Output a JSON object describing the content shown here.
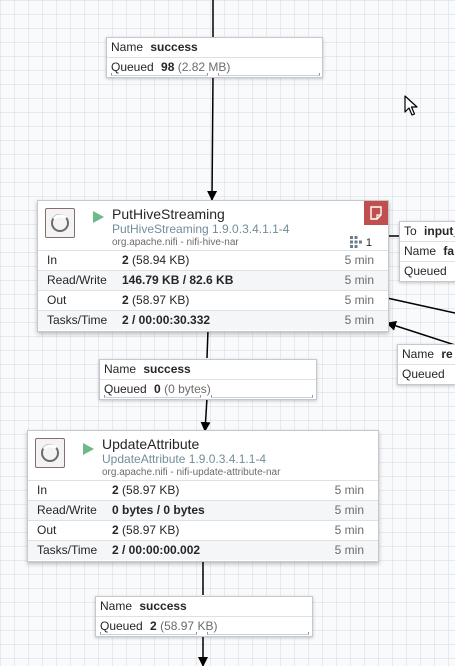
{
  "conn_top": {
    "name_label": "Name",
    "name_value": "success",
    "queued_label": "Queued",
    "queued_count": "98",
    "queued_size": "(2.82 MB)"
  },
  "conn_mid": {
    "name_label": "Name",
    "name_value": "success",
    "queued_label": "Queued",
    "queued_count": "0",
    "queued_size": "(0 bytes)"
  },
  "conn_bottom": {
    "name_label": "Name",
    "name_value": "success",
    "queued_label": "Queued",
    "queued_count": "2",
    "queued_size": "(58.97 KB)"
  },
  "conn_right_top": {
    "to_label": "To",
    "to_value": "input_",
    "name_label": "Name",
    "name_value": "fa",
    "queued_label": "Queued"
  },
  "conn_right_bottom": {
    "name_label": "Name",
    "name_value": "re",
    "queued_label": "Queued"
  },
  "proc_hive": {
    "name": "PutHiveStreaming",
    "version": "PutHiveStreaming 1.9.0.3.4.1.1-4",
    "bundle": "org.apache.nifi - nifi-hive-nar",
    "task_count": "1",
    "stats": [
      {
        "label": "In",
        "value": "2",
        "detail": "(58.94 KB)",
        "time": "5 min"
      },
      {
        "label": "Read/Write",
        "value": "146.79 KB / 82.6 KB",
        "detail": "",
        "time": "5 min"
      },
      {
        "label": "Out",
        "value": "2",
        "detail": "(58.97 KB)",
        "time": "5 min"
      },
      {
        "label": "Tasks/Time",
        "value": "2 / 00:00:30.332",
        "detail": "",
        "time": "5 min"
      }
    ]
  },
  "proc_update": {
    "name": "UpdateAttribute",
    "version": "UpdateAttribute 1.9.0.3.4.1.1-4",
    "bundle": "org.apache.nifi - nifi-update-attribute-nar",
    "stats": [
      {
        "label": "In",
        "value": "2",
        "detail": "(58.97 KB)",
        "time": "5 min"
      },
      {
        "label": "Read/Write",
        "value": "0 bytes / 0 bytes",
        "detail": "",
        "time": "5 min"
      },
      {
        "label": "Out",
        "value": "2",
        "detail": "(58.97 KB)",
        "time": "5 min"
      },
      {
        "label": "Tasks/Time",
        "value": "2 / 00:00:00.002",
        "detail": "",
        "time": "5 min"
      }
    ]
  },
  "colors": {
    "run_indicator": "#6fb88a",
    "bulletin_badge": "#c0504d",
    "version_text": "#728e9b"
  },
  "icons": {
    "processor": "processor-icon",
    "running": "play-icon",
    "bulletin": "bulletin-icon",
    "tasks": "active-threads-icon",
    "cursor": "mouse-cursor-icon"
  }
}
